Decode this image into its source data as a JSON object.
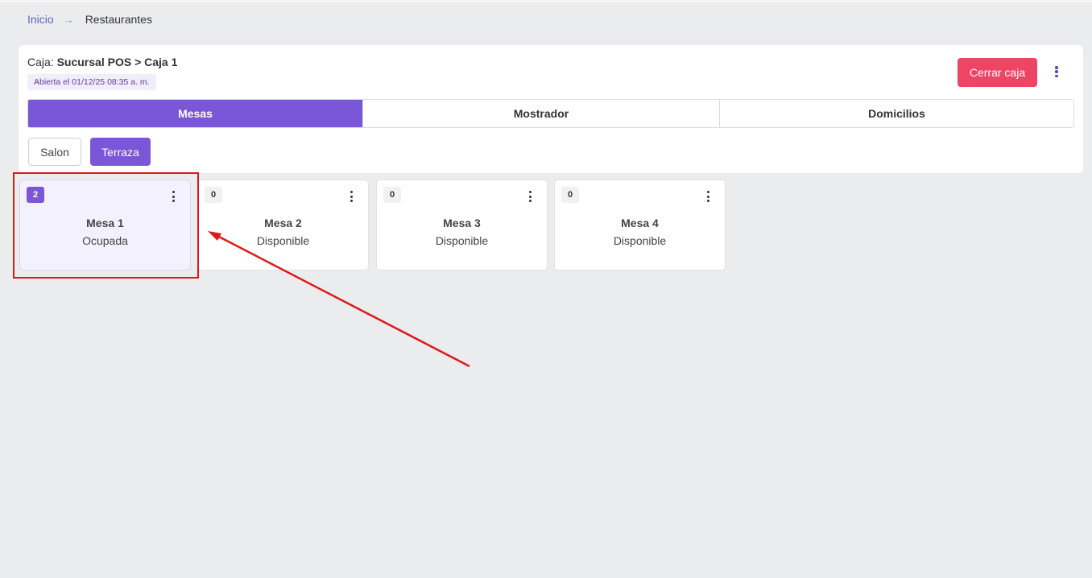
{
  "breadcrumb": {
    "home": "Inicio",
    "separator": "→",
    "current": "Restaurantes"
  },
  "register": {
    "prefix": "Caja:",
    "branch": "Sucursal POS",
    "chevron": ">",
    "name": "Caja 1",
    "opened": "Abierta el 01/12/25 08:35 a. m.",
    "close_label": "Cerrar caja",
    "menu_icon": "kebab-vertical-icon"
  },
  "tabs": [
    {
      "label": "Mesas",
      "active": true
    },
    {
      "label": "Mostrador",
      "active": false
    },
    {
      "label": "Domicilios",
      "active": false
    }
  ],
  "zones": [
    {
      "label": "Salon",
      "active": false
    },
    {
      "label": "Terraza",
      "active": true
    }
  ],
  "tables": [
    {
      "count": "2",
      "name": "Mesa 1",
      "status": "Ocupada"
    },
    {
      "count": "0",
      "name": "Mesa 2",
      "status": "Disponible"
    },
    {
      "count": "0",
      "name": "Mesa 3",
      "status": "Disponible"
    },
    {
      "count": "0",
      "name": "Mesa 4",
      "status": "Disponible"
    }
  ],
  "colors": {
    "accent": "#7a57d6",
    "danger": "#ee4565",
    "annotation": "#e01818",
    "background": "#ebecee"
  }
}
